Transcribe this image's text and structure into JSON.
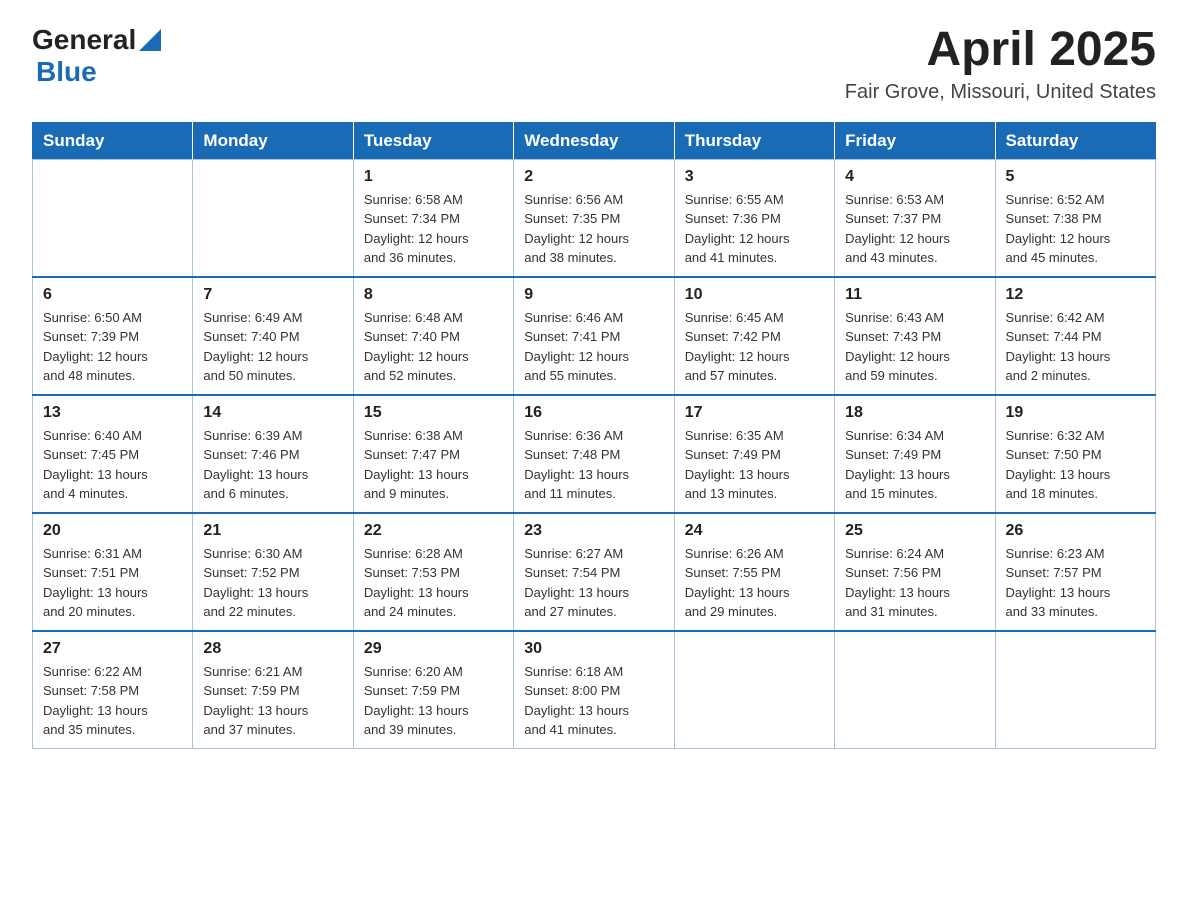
{
  "header": {
    "logo_general": "General",
    "logo_blue": "Blue",
    "month_year": "April 2025",
    "location": "Fair Grove, Missouri, United States"
  },
  "days_of_week": [
    "Sunday",
    "Monday",
    "Tuesday",
    "Wednesday",
    "Thursday",
    "Friday",
    "Saturday"
  ],
  "weeks": [
    [
      {
        "day": "",
        "info": ""
      },
      {
        "day": "",
        "info": ""
      },
      {
        "day": "1",
        "info": "Sunrise: 6:58 AM\nSunset: 7:34 PM\nDaylight: 12 hours\nand 36 minutes."
      },
      {
        "day": "2",
        "info": "Sunrise: 6:56 AM\nSunset: 7:35 PM\nDaylight: 12 hours\nand 38 minutes."
      },
      {
        "day": "3",
        "info": "Sunrise: 6:55 AM\nSunset: 7:36 PM\nDaylight: 12 hours\nand 41 minutes."
      },
      {
        "day": "4",
        "info": "Sunrise: 6:53 AM\nSunset: 7:37 PM\nDaylight: 12 hours\nand 43 minutes."
      },
      {
        "day": "5",
        "info": "Sunrise: 6:52 AM\nSunset: 7:38 PM\nDaylight: 12 hours\nand 45 minutes."
      }
    ],
    [
      {
        "day": "6",
        "info": "Sunrise: 6:50 AM\nSunset: 7:39 PM\nDaylight: 12 hours\nand 48 minutes."
      },
      {
        "day": "7",
        "info": "Sunrise: 6:49 AM\nSunset: 7:40 PM\nDaylight: 12 hours\nand 50 minutes."
      },
      {
        "day": "8",
        "info": "Sunrise: 6:48 AM\nSunset: 7:40 PM\nDaylight: 12 hours\nand 52 minutes."
      },
      {
        "day": "9",
        "info": "Sunrise: 6:46 AM\nSunset: 7:41 PM\nDaylight: 12 hours\nand 55 minutes."
      },
      {
        "day": "10",
        "info": "Sunrise: 6:45 AM\nSunset: 7:42 PM\nDaylight: 12 hours\nand 57 minutes."
      },
      {
        "day": "11",
        "info": "Sunrise: 6:43 AM\nSunset: 7:43 PM\nDaylight: 12 hours\nand 59 minutes."
      },
      {
        "day": "12",
        "info": "Sunrise: 6:42 AM\nSunset: 7:44 PM\nDaylight: 13 hours\nand 2 minutes."
      }
    ],
    [
      {
        "day": "13",
        "info": "Sunrise: 6:40 AM\nSunset: 7:45 PM\nDaylight: 13 hours\nand 4 minutes."
      },
      {
        "day": "14",
        "info": "Sunrise: 6:39 AM\nSunset: 7:46 PM\nDaylight: 13 hours\nand 6 minutes."
      },
      {
        "day": "15",
        "info": "Sunrise: 6:38 AM\nSunset: 7:47 PM\nDaylight: 13 hours\nand 9 minutes."
      },
      {
        "day": "16",
        "info": "Sunrise: 6:36 AM\nSunset: 7:48 PM\nDaylight: 13 hours\nand 11 minutes."
      },
      {
        "day": "17",
        "info": "Sunrise: 6:35 AM\nSunset: 7:49 PM\nDaylight: 13 hours\nand 13 minutes."
      },
      {
        "day": "18",
        "info": "Sunrise: 6:34 AM\nSunset: 7:49 PM\nDaylight: 13 hours\nand 15 minutes."
      },
      {
        "day": "19",
        "info": "Sunrise: 6:32 AM\nSunset: 7:50 PM\nDaylight: 13 hours\nand 18 minutes."
      }
    ],
    [
      {
        "day": "20",
        "info": "Sunrise: 6:31 AM\nSunset: 7:51 PM\nDaylight: 13 hours\nand 20 minutes."
      },
      {
        "day": "21",
        "info": "Sunrise: 6:30 AM\nSunset: 7:52 PM\nDaylight: 13 hours\nand 22 minutes."
      },
      {
        "day": "22",
        "info": "Sunrise: 6:28 AM\nSunset: 7:53 PM\nDaylight: 13 hours\nand 24 minutes."
      },
      {
        "day": "23",
        "info": "Sunrise: 6:27 AM\nSunset: 7:54 PM\nDaylight: 13 hours\nand 27 minutes."
      },
      {
        "day": "24",
        "info": "Sunrise: 6:26 AM\nSunset: 7:55 PM\nDaylight: 13 hours\nand 29 minutes."
      },
      {
        "day": "25",
        "info": "Sunrise: 6:24 AM\nSunset: 7:56 PM\nDaylight: 13 hours\nand 31 minutes."
      },
      {
        "day": "26",
        "info": "Sunrise: 6:23 AM\nSunset: 7:57 PM\nDaylight: 13 hours\nand 33 minutes."
      }
    ],
    [
      {
        "day": "27",
        "info": "Sunrise: 6:22 AM\nSunset: 7:58 PM\nDaylight: 13 hours\nand 35 minutes."
      },
      {
        "day": "28",
        "info": "Sunrise: 6:21 AM\nSunset: 7:59 PM\nDaylight: 13 hours\nand 37 minutes."
      },
      {
        "day": "29",
        "info": "Sunrise: 6:20 AM\nSunset: 7:59 PM\nDaylight: 13 hours\nand 39 minutes."
      },
      {
        "day": "30",
        "info": "Sunrise: 6:18 AM\nSunset: 8:00 PM\nDaylight: 13 hours\nand 41 minutes."
      },
      {
        "day": "",
        "info": ""
      },
      {
        "day": "",
        "info": ""
      },
      {
        "day": "",
        "info": ""
      }
    ]
  ]
}
